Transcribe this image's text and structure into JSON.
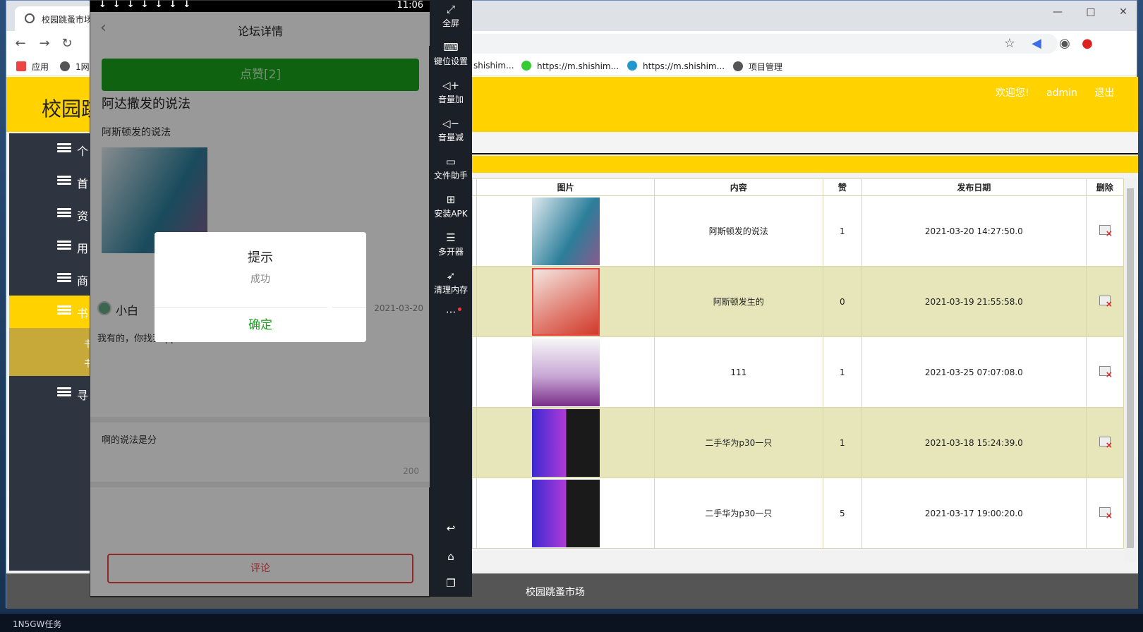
{
  "browser": {
    "tab_title": "校园跳蚤市场",
    "bookmarks": [
      "应用",
      "1网",
      "shishim...",
      "https://m.shishim...",
      "https://m.shishim...",
      "项目管理"
    ]
  },
  "site": {
    "title": "校园跳蚤市场",
    "title_visible": "校园跳",
    "welcome": "欢迎您!",
    "user": "admin",
    "logout": "退出",
    "footer": "校园跳蚤市场"
  },
  "nav": {
    "items": [
      "个",
      "首",
      "资",
      "用",
      "商",
      "书",
      "寻"
    ],
    "active_index": 5,
    "sub_items": [
      "书",
      "书"
    ]
  },
  "table": {
    "headers": [
      "图片",
      "内容",
      "赞",
      "发布日期",
      "删除"
    ],
    "rows": [
      {
        "content": "阿斯顿发的说法",
        "likes": "1",
        "date": "2021-03-20 14:27:50.0",
        "image": "book-cover"
      },
      {
        "content": "阿斯顿发生的",
        "likes": "0",
        "date": "2021-03-19 21:55:58.0",
        "image": "product-ad"
      },
      {
        "content": "111",
        "likes": "1",
        "date": "2021-03-25 07:07:08.0",
        "image": "python-book"
      },
      {
        "content": "二手华为p30一只",
        "likes": "1",
        "date": "2021-03-18 15:24:39.0",
        "image": "phone-ad"
      },
      {
        "content": "二手华为p30一只",
        "likes": "5",
        "date": "2021-03-17 19:00:20.0",
        "image": "phone-ad"
      }
    ]
  },
  "phone": {
    "time": "11:06",
    "nav_title": "论坛详情",
    "like_button": "点赞[2]",
    "post_title": "阿达撒发的说法",
    "post_body": "阿斯顿发的说法",
    "comment_user": "小白",
    "comment_date": "2021-03-20",
    "comment_text": "我有的，你找我qq11111",
    "input_text": "啊的说法是分",
    "input_count": "200",
    "submit": "评论",
    "dialog": {
      "title": "提示",
      "message": "成功",
      "confirm": "确定"
    }
  },
  "emulator": {
    "buttons": [
      "全屏",
      "键位设置",
      "音量加",
      "音量减",
      "文件助手",
      "安装APK",
      "多开器",
      "清理内存"
    ]
  },
  "taskbar": {
    "left_text": "任务",
    "left_text2": "1N5GW任务"
  },
  "colors": {
    "brand_yellow": "#ffd200",
    "nav_dark": "#2f3540",
    "like_green": "#1aa31a",
    "alt_row": "#e7e6bb"
  }
}
